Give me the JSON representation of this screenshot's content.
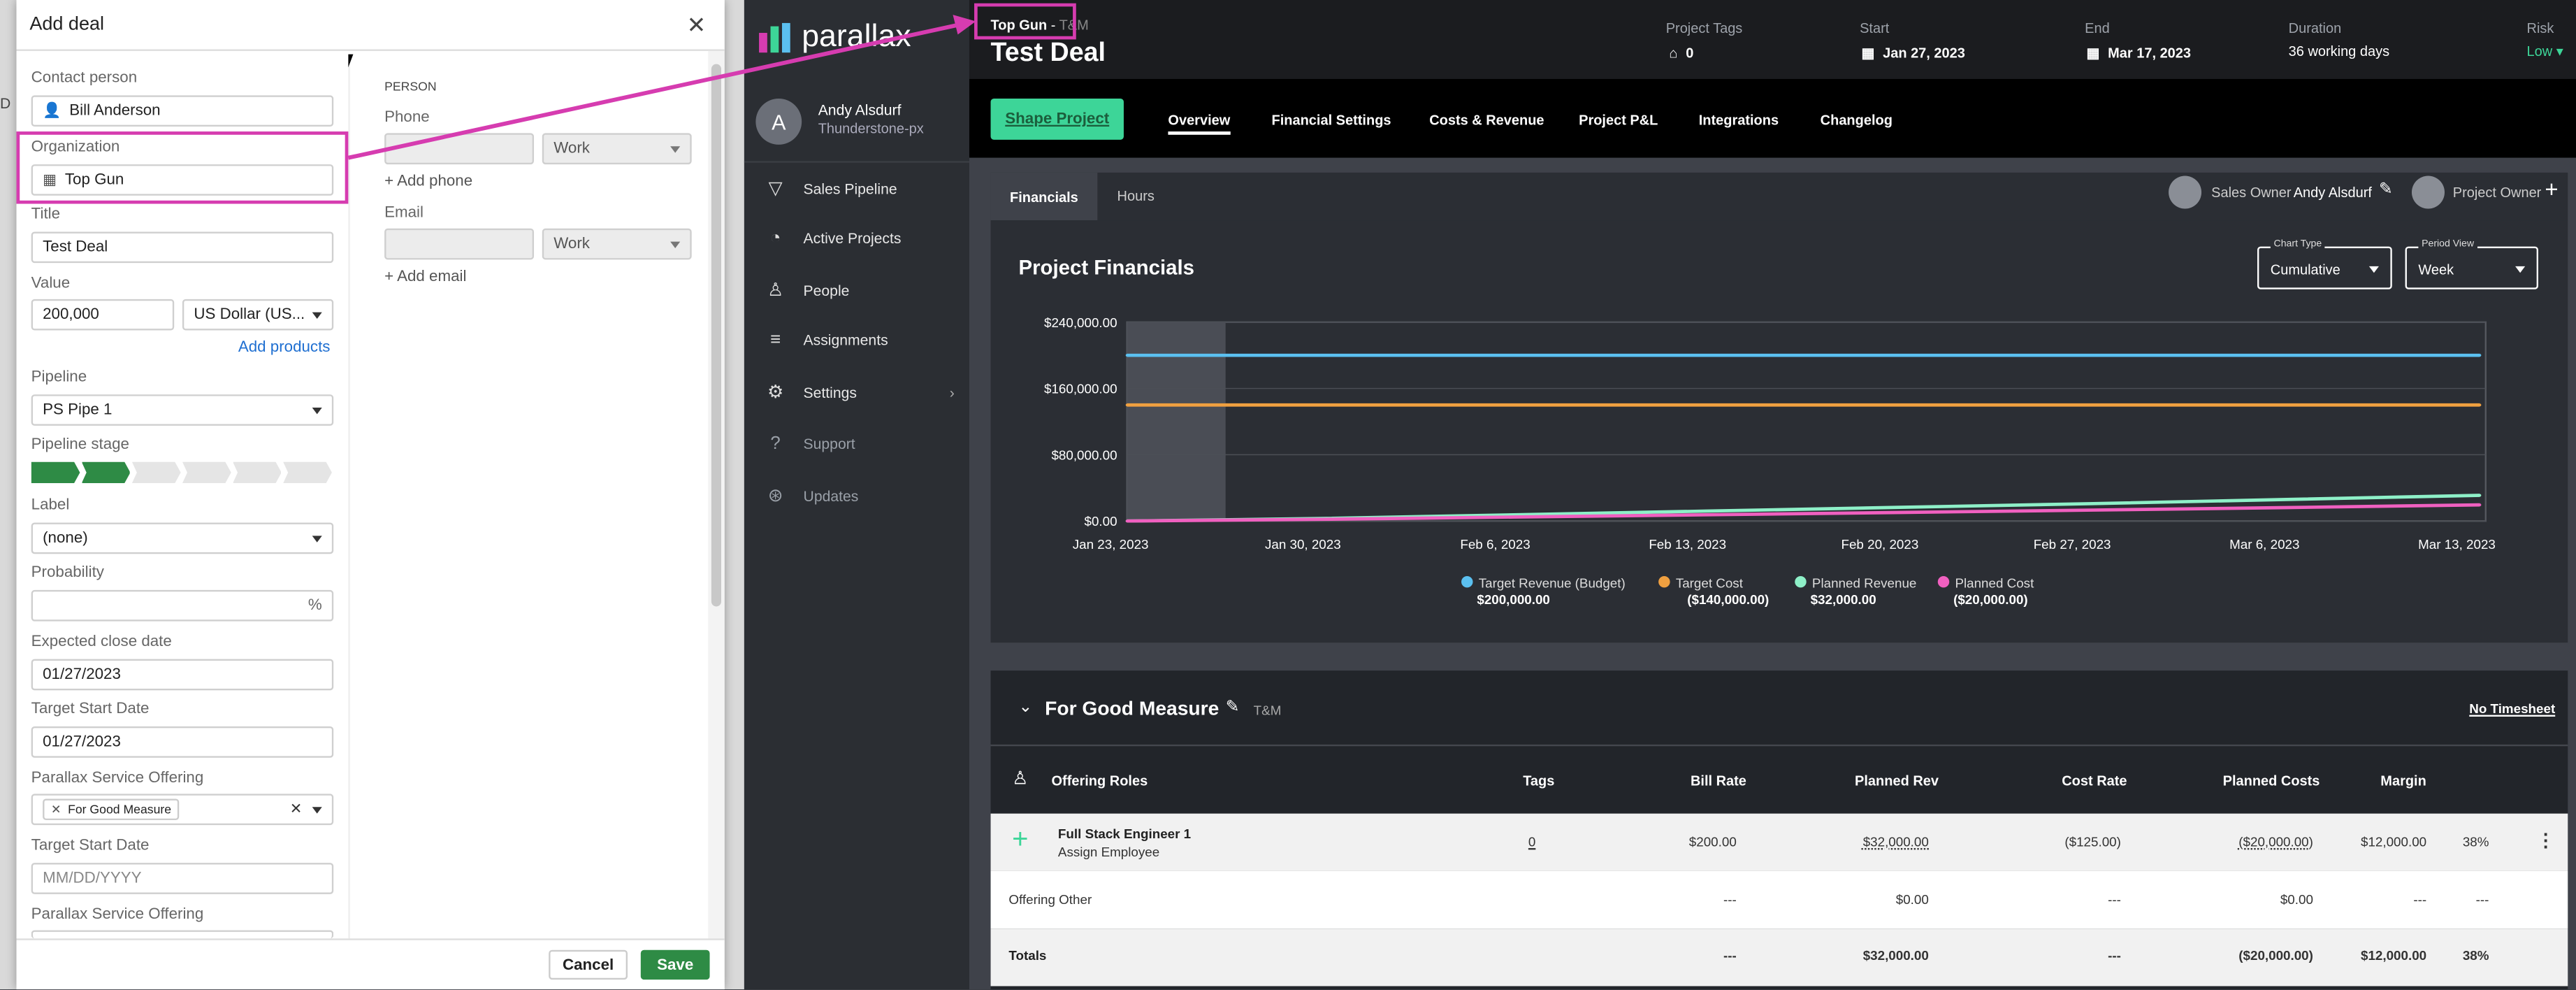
{
  "modal": {
    "title": "Add deal",
    "contact_label": "Contact person",
    "contact_value": "Bill Anderson",
    "org_label": "Organization",
    "org_value": "Top Gun",
    "title_label": "Title",
    "title_value": "Test Deal",
    "value_label": "Value",
    "value_amount": "200,000",
    "currency": "US Dollar (US...",
    "add_products": "Add products",
    "pipeline_label": "Pipeline",
    "pipeline_value": "PS Pipe 1",
    "stage_label": "Pipeline stage",
    "stage_count": 6,
    "stage_active": 2,
    "label_label": "Label",
    "label_value": "(none)",
    "probability_label": "Probability",
    "probability_suffix": "%",
    "close_date_label": "Expected close date",
    "close_date_value": "01/27/2023",
    "target_start_label": "Target Start Date",
    "target_start_value": "01/27/2023",
    "offering_label": "Parallax Service Offering",
    "offering_tag": "For Good Measure",
    "target_start_label_2": "Target Start Date",
    "target_start_placeholder": "MM/DD/YYYY",
    "offering_label_2": "Parallax Service Offering",
    "person_heading": "PERSON",
    "phone_label": "Phone",
    "phone_type": "Work",
    "add_phone": "+ Add phone",
    "email_label": "Email",
    "email_type": "Work",
    "add_email": "+ Add email",
    "cancel": "Cancel",
    "save": "Save"
  },
  "brand": {
    "name": "parallax"
  },
  "user": {
    "initial": "A",
    "name": "Andy Alsdurf",
    "org": "Thunderstone-px"
  },
  "sidebar": {
    "items": [
      {
        "label": "Sales Pipeline",
        "icon": "funnel-icon"
      },
      {
        "label": "Active Projects",
        "icon": "pie-icon"
      },
      {
        "label": "People",
        "icon": "person-icon"
      },
      {
        "label": "Assignments",
        "icon": "bars-icon"
      },
      {
        "label": "Settings",
        "icon": "gear-icon"
      },
      {
        "label": "Support",
        "icon": "help-icon"
      },
      {
        "label": "Updates",
        "icon": "updates-icon"
      }
    ]
  },
  "header": {
    "breadcrumb_org": "Top Gun",
    "breadcrumb_sep": " - ",
    "breadcrumb_type": "T&M",
    "deal_title": "Test Deal",
    "tags_label": "Project Tags",
    "tags_value": "0",
    "start_label": "Start",
    "start_value": "Jan 27, 2023",
    "end_label": "End",
    "end_value": "Mar 17, 2023",
    "duration_label": "Duration",
    "duration_value": "36 working days",
    "risk_label": "Risk",
    "risk_value": "Low"
  },
  "tabs": {
    "shape_button": "Shape Project",
    "items": [
      "Overview",
      "Financial Settings",
      "Costs & Revenue",
      "Project P&L",
      "Integrations",
      "Changelog"
    ]
  },
  "subtabs": {
    "financials": "Financials",
    "hours": "Hours"
  },
  "owners": {
    "sales_label": "Sales Owner",
    "sales_name": "Andy Alsdurf",
    "project_label": "Project Owner"
  },
  "chart_controls": {
    "type_label": "Chart Type",
    "type_value": "Cumulative",
    "period_label": "Period View",
    "period_value": "Week"
  },
  "chart_data": {
    "type": "line",
    "title": "Project Financials",
    "x": [
      "Jan 23, 2023",
      "Jan 30, 2023",
      "Feb 6, 2023",
      "Feb 13, 2023",
      "Feb 20, 2023",
      "Feb 27, 2023",
      "Mar 6, 2023",
      "Mar 13, 2023"
    ],
    "yticks": [
      "$240,000.00",
      "$160,000.00",
      "$80,000.00",
      "$0.00"
    ],
    "ylim": [
      0,
      240000
    ],
    "series": [
      {
        "name": "Target Revenue (Budget)",
        "total": "$200,000.00",
        "color": "#5bc0f0",
        "values": [
          200000,
          200000,
          200000,
          200000,
          200000,
          200000,
          200000,
          200000
        ]
      },
      {
        "name": "Target Cost",
        "total": "($140,000.00)",
        "color": "#f0a040",
        "values": [
          140000,
          140000,
          140000,
          140000,
          140000,
          140000,
          140000,
          140000
        ]
      },
      {
        "name": "Planned Revenue",
        "total": "$32,000.00",
        "color": "#8ef0c8",
        "values": [
          0,
          3000,
          7500,
          12000,
          16500,
          21000,
          26000,
          31000
        ]
      },
      {
        "name": "Planned Cost",
        "total": "($20,000.00)",
        "color": "#f060c0",
        "values": [
          0,
          2000,
          4800,
          7500,
          10300,
          13200,
          16200,
          19500
        ]
      }
    ]
  },
  "offering": {
    "name": "For Good Measure",
    "type": "T&M",
    "no_timesheet": "No Timesheet",
    "columns": [
      "Offering Roles",
      "Tags",
      "Bill Rate",
      "Planned Rev",
      "Cost Rate",
      "Planned Costs",
      "Margin"
    ],
    "row1": {
      "role": "Full Stack Engineer 1",
      "sub": "Assign Employee",
      "tags": "0",
      "bill": "$200.00",
      "rev": "$32,000.00",
      "cost": "($125.00)",
      "costs": "($20,000.00)",
      "margin": "$12,000.00",
      "pct": "38%"
    },
    "row2": {
      "role": "Offering Other",
      "bill": "---",
      "rev": "$0.00",
      "cost": "---",
      "costs": "$0.00",
      "margin": "---",
      "pct": "---"
    },
    "totals": {
      "label": "Totals",
      "bill": "---",
      "rev": "$32,000.00",
      "cost": "---",
      "costs": "($20,000.00)",
      "margin": "$12,000.00",
      "pct": "38%"
    }
  },
  "colors": {
    "accent_green": "#3dd598",
    "annotation": "#d63cb0",
    "save_green": "#2e8b45"
  }
}
